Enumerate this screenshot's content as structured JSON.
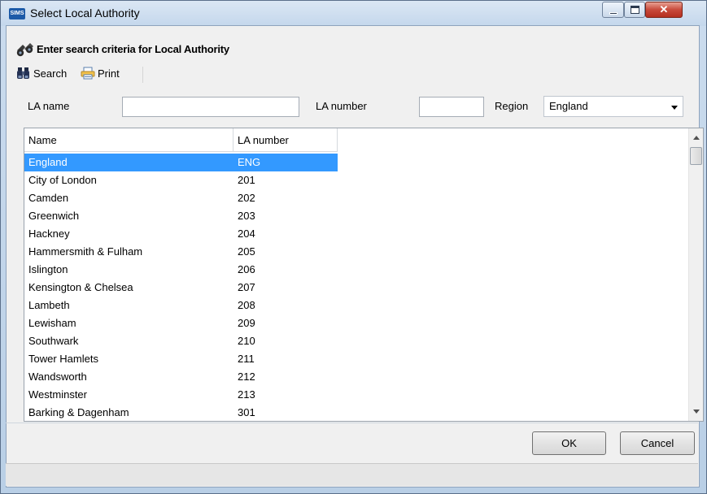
{
  "window": {
    "title": "Select Local Authority",
    "app_icon_text": "SIMS",
    "close_glyph": "✕"
  },
  "header": {
    "title": "Enter search criteria for Local Authority",
    "icon": "binoculars-icon"
  },
  "toolbar": {
    "search_label": "Search",
    "search_icon": "binoculars-icon",
    "print_label": "Print",
    "print_icon": "printer-icon"
  },
  "filters": {
    "la_name_label": "LA name",
    "la_name_value": "",
    "la_number_label": "LA number",
    "la_number_value": "",
    "region_label": "Region",
    "region_value": "England"
  },
  "grid": {
    "columns": [
      "Name",
      "LA number"
    ],
    "selected_index": 0,
    "rows": [
      {
        "name": "England",
        "number": "ENG"
      },
      {
        "name": "City of London",
        "number": "201"
      },
      {
        "name": "Camden",
        "number": "202"
      },
      {
        "name": "Greenwich",
        "number": "203"
      },
      {
        "name": "Hackney",
        "number": "204"
      },
      {
        "name": "Hammersmith & Fulham",
        "number": "205"
      },
      {
        "name": "Islington",
        "number": "206"
      },
      {
        "name": "Kensington & Chelsea",
        "number": "207"
      },
      {
        "name": "Lambeth",
        "number": "208"
      },
      {
        "name": "Lewisham",
        "number": "209"
      },
      {
        "name": "Southwark",
        "number": "210"
      },
      {
        "name": "Tower Hamlets",
        "number": "211"
      },
      {
        "name": "Wandsworth",
        "number": "212"
      },
      {
        "name": "Westminster",
        "number": "213"
      },
      {
        "name": "Barking & Dagenham",
        "number": "301"
      }
    ]
  },
  "buttons": {
    "ok_label": "OK",
    "cancel_label": "Cancel"
  },
  "colors": {
    "selection": "#3399ff",
    "title_bar": "#c4d7ec",
    "close_button": "#c8493a"
  }
}
